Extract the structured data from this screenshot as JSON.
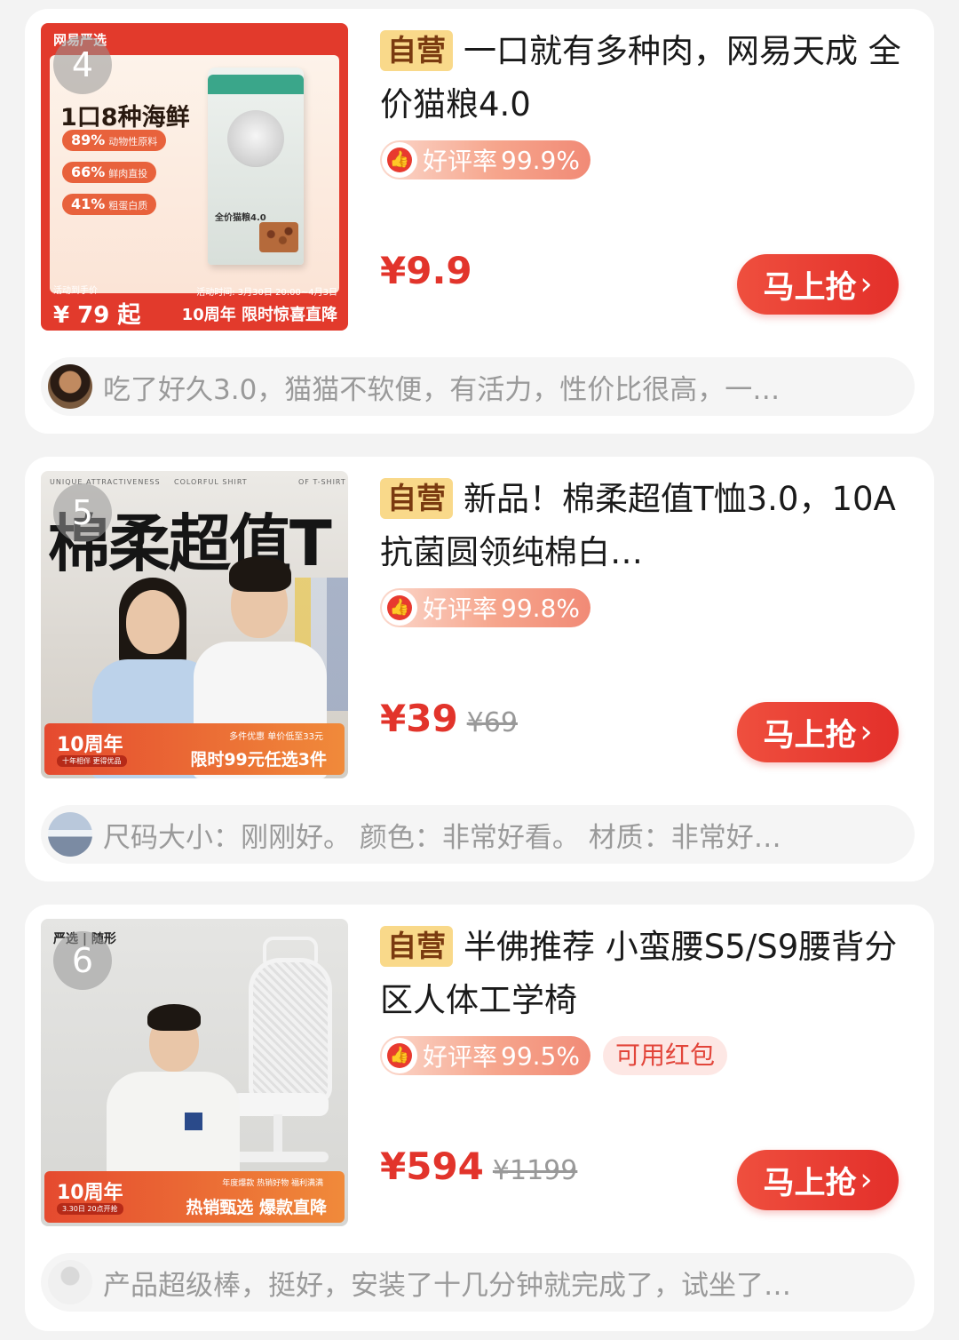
{
  "products": [
    {
      "rank": "4",
      "tag": "自营",
      "title": "一口就有多种肉，网易天成 全价猫粮4.0",
      "rating_label": "好评率",
      "rating_value": "99.9%",
      "price": "¥9.9",
      "buy_label": "马上抢",
      "review": "吃了好久3.0，猫猫不软便，有活力，性价比很高，一…",
      "image": {
        "brand": "网易严选",
        "headline": "1口8种海鲜",
        "pills": [
          {
            "pct": "89%",
            "text": "动物性原料"
          },
          {
            "pct": "66%",
            "text": "鲜肉直投"
          },
          {
            "pct": "41%",
            "text": "粗蛋白质"
          }
        ],
        "bag_label": "全价猫粮4.0",
        "note": "活动到手价",
        "price": "¥  79  起",
        "time": "活动时间: 3月30日 20:00~4月3日",
        "promo": "10周年 限时惊喜直降"
      }
    },
    {
      "rank": "5",
      "tag": "自营",
      "title": "新品！棉柔超值T恤3.0，10A抗菌圆领纯棉白…",
      "rating_label": "好评率",
      "rating_value": "99.8%",
      "price": "¥39",
      "original_price": "¥69",
      "buy_label": "马上抢",
      "review": "尺码大小：刚刚好。 颜色：非常好看。 材质：非常好…",
      "image": {
        "tiny_left": "UNIQUE ATTRACTIVENESS",
        "tiny_mid": "COLORFUL SHIRT",
        "tiny_right": "OF T-SHIRT",
        "big": "棉柔超值T",
        "anniv": "10周年",
        "sub": "十年相伴 更得优品",
        "r1": "多件优惠 单价低至33元",
        "r2": "限时99元任选3件"
      }
    },
    {
      "rank": "6",
      "tag": "自营",
      "title": "半佛推荐 小蛮腰S5/S9腰背分区人体工学椅",
      "rating_label": "好评率",
      "rating_value": "99.5%",
      "coupon": "可用红包",
      "price": "¥594",
      "original_price": "¥1199",
      "buy_label": "马上抢",
      "review": "产品超级棒，挺好，安装了十几分钟就完成了，试坐了…",
      "image": {
        "brand": "严选 | 随形",
        "anniv": "10周年",
        "sub": "3.30日 20点开抢",
        "r1": "年度爆款  热销好物  福利满满",
        "r2": "热销甄选 爆款直降"
      }
    }
  ],
  "colors": {
    "accent_red": "#e2342b",
    "self_tag_bg": "#f9d98a",
    "rating_pill": "#f18a76"
  }
}
